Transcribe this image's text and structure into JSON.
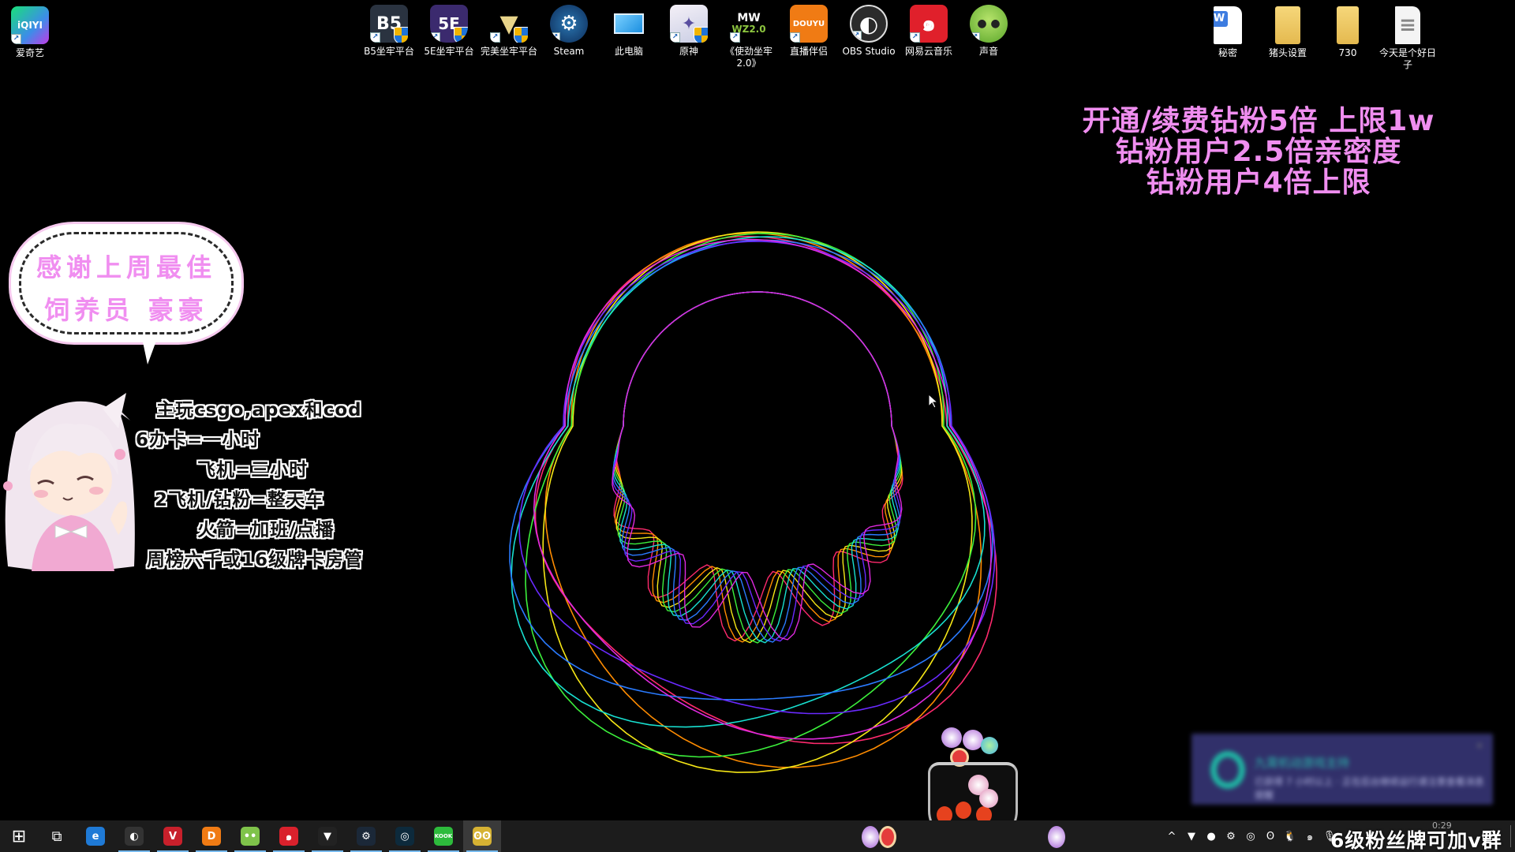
{
  "desktop_icons_left": [
    {
      "label": "爱奇艺",
      "icon": "iqiyi-icon",
      "glyph": "iQIYI"
    }
  ],
  "desktop_icons_top": [
    {
      "label": "B5坐牢平台",
      "icon": "b5-platform-icon",
      "glyph": "B5"
    },
    {
      "label": "5E坐牢平台",
      "icon": "5e-platform-icon",
      "glyph": "5E"
    },
    {
      "label": "完美坐牢平台",
      "icon": "perfect-world-platform-icon",
      "glyph": "▼"
    },
    {
      "label": "Steam",
      "icon": "steam-icon",
      "glyph": "⚙"
    },
    {
      "label": "此电脑",
      "icon": "this-pc-icon",
      "glyph": "🖥"
    },
    {
      "label": "原神",
      "icon": "genshin-icon",
      "glyph": "✦"
    },
    {
      "label": "《使劲坐牢 2.0》",
      "icon": "mw-wz2-icon",
      "glyph": "WZ2.0"
    },
    {
      "label": "直播伴侣",
      "icon": "douyu-live-icon",
      "glyph": "DOUYU"
    },
    {
      "label": "OBS Studio",
      "icon": "obs-icon",
      "glyph": "◐"
    },
    {
      "label": "网易云音乐",
      "icon": "netease-music-icon",
      "glyph": "๑"
    },
    {
      "label": "声音",
      "icon": "sound-app-icon",
      "glyph": "● ●"
    }
  ],
  "desktop_icons_right": [
    {
      "label": "秘密",
      "icon": "word-document-icon",
      "glyph": "W"
    },
    {
      "label": "猪头设置",
      "icon": "folder-icon",
      "glyph": ""
    },
    {
      "label": "730",
      "icon": "folder-icon",
      "glyph": ""
    },
    {
      "label": "今天是个好日子",
      "icon": "text-document-icon",
      "glyph": "≡"
    }
  ],
  "promo": {
    "lines": [
      "开通/续费钻粉5倍  上限1w",
      "钻粉用户2.5倍亲密度",
      "钻粉用户4倍上限"
    ],
    "color": "#f08ef0"
  },
  "bubble": {
    "lines": [
      "感谢上周最佳",
      "饲养员 豪豪"
    ]
  },
  "info": {
    "lines": [
      "主玩csgo,apex和cod",
      "6办卡=一小时",
      "飞机=三小时",
      "2飞机/钻粉=整天车",
      "火箭=加班/点播",
      "周榜六千或16级牌卡房管"
    ]
  },
  "notification": {
    "title": "九霄机动游戏主持",
    "body": "已获得 7 小时以上 · 正在后台继续运行请注意查看消息提醒",
    "close": "×"
  },
  "taskbar": {
    "start": "⊞",
    "task_view": "⧉",
    "apps": [
      {
        "name": "edge",
        "glyph": "e",
        "bg": "#1f7ad6",
        "running": false
      },
      {
        "name": "obs",
        "glyph": "◐",
        "bg": "#333",
        "running": true
      },
      {
        "name": "wps-pdf",
        "glyph": "V",
        "bg": "#c8202b",
        "running": true
      },
      {
        "name": "douyu",
        "glyph": "D",
        "bg": "#f07b14",
        "running": true
      },
      {
        "name": "sound-app",
        "glyph": "••",
        "bg": "#7fc34a",
        "running": true
      },
      {
        "name": "netease-music",
        "glyph": "๑",
        "bg": "#d9212c",
        "running": true
      },
      {
        "name": "perfect-world",
        "glyph": "▼",
        "bg": "#222",
        "running": true
      },
      {
        "name": "steam",
        "glyph": "⚙",
        "bg": "#1b2838",
        "running": true
      },
      {
        "name": "5e-client",
        "glyph": "◎",
        "bg": "#0d2a3c",
        "running": true
      },
      {
        "name": "kook",
        "glyph": "KOOK",
        "bg": "#2dbb3c",
        "running": true
      },
      {
        "name": "raccoon-app",
        "glyph": "ʘʘ",
        "bg": "#d6b233",
        "running": true
      }
    ],
    "tray": [
      {
        "name": "chevron-up",
        "glyph": "^"
      },
      {
        "name": "perfect-world-tray",
        "glyph": "▼"
      },
      {
        "name": "wechat-tray",
        "glyph": "●"
      },
      {
        "name": "steam-tray",
        "glyph": "⚙"
      },
      {
        "name": "5e-tray",
        "glyph": "◎"
      },
      {
        "name": "raccoon-tray",
        "glyph": "ʘ"
      },
      {
        "name": "qq-tray",
        "glyph": "🐧"
      },
      {
        "name": "netease-tray",
        "glyph": "๑"
      },
      {
        "name": "microphone-tray",
        "glyph": "🎙"
      }
    ],
    "clock_time": "0:29",
    "overlay_text": "6级粉丝牌可加v群",
    "notification_center": "▭"
  }
}
